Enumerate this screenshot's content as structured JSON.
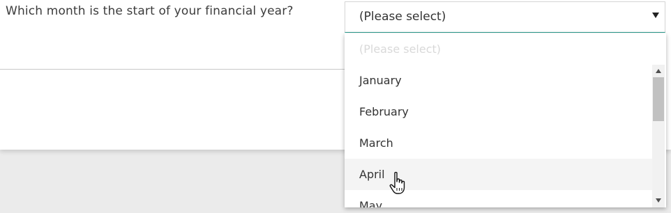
{
  "form": {
    "question": "Which month is the start of your financial year?"
  },
  "select": {
    "value": "(Please select)"
  },
  "dropdown": {
    "placeholder": "(Please select)",
    "options": [
      "January",
      "February",
      "March",
      "April",
      "May"
    ],
    "hovered_option": "April"
  },
  "icons": {
    "caret": "caret-down-icon",
    "scroll_up": "scroll-up-arrow-icon",
    "scroll_down": "scroll-down-arrow-icon",
    "cursor": "hand-pointer-cursor-icon"
  },
  "colors": {
    "accent_underline": "#2a9d8f",
    "hover_background": "#f4f4f4",
    "placeholder_text": "#d9d9d9",
    "page_background": "#ebebeb"
  }
}
